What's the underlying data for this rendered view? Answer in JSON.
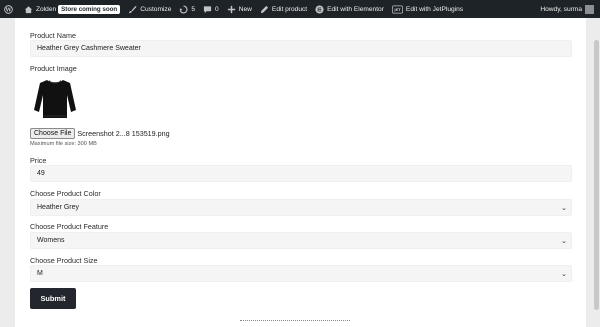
{
  "adminbar": {
    "wp_icon": "wordpress-icon",
    "site_name": "Zolden",
    "store_badge": "Store coming soon",
    "customize": "Customize",
    "updates_count": "5",
    "comments_count": "0",
    "new": "New",
    "edit_product": "Edit product",
    "edit_elementor": "Edit with Elementor",
    "jet_badge": "JET",
    "edit_jetplugins": "Edit with JetPlugins",
    "howdy": "Howdy, surma"
  },
  "form": {
    "product_name_label": "Product Name",
    "product_name_value": "Heather Grey Cashmere Sweater",
    "product_image_label": "Product Image",
    "choose_file_label": "Choose File",
    "file_name": "Screenshot 2...8 153519.png",
    "max_size_hint": "Maximum file size: 300 MB",
    "price_label": "Price",
    "price_value": "49",
    "color_label": "Choose Product Color",
    "color_value": "Heather Grey",
    "feature_label": "Choose Product Feature",
    "feature_value": "Womens",
    "size_label": "Choose Product Size",
    "size_value": "M",
    "submit_label": "Submit"
  },
  "colors": {
    "adminbar_bg": "#1d2327",
    "submit_bg": "#24262e",
    "field_bg": "#f5f5f5"
  }
}
